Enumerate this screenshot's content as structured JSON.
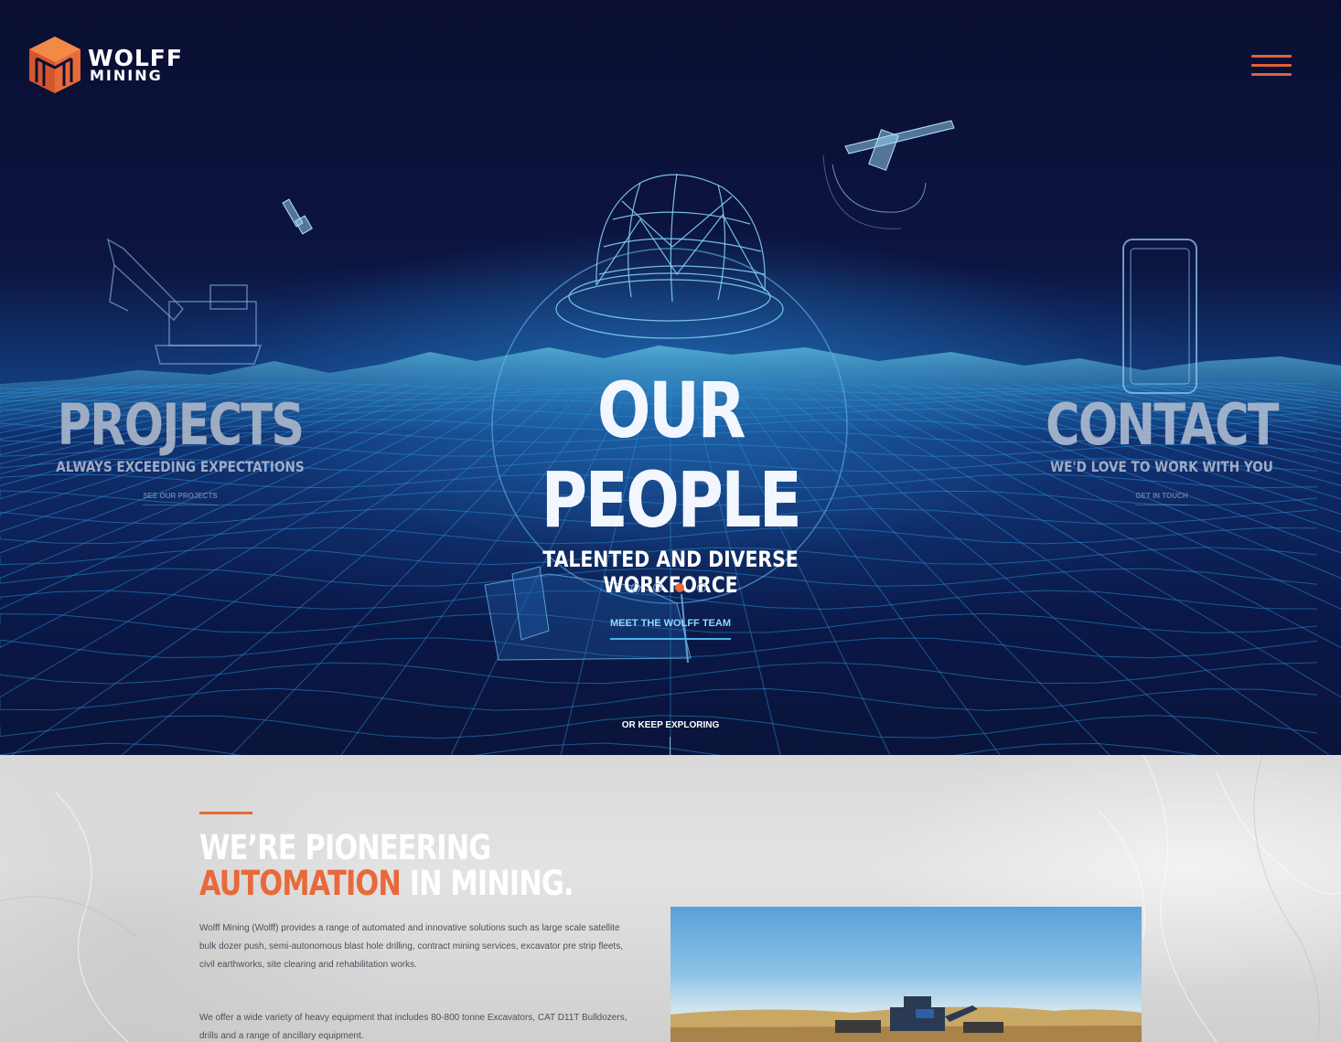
{
  "header": {
    "logo_line1": "WOLFF",
    "logo_line2": "MINING",
    "menu_icon": "hamburger-menu-icon"
  },
  "hero": {
    "panels": [
      {
        "title": "PROJECTS",
        "subtitle": "ALWAYS EXCEEDING EXPECTATIONS",
        "link": "SEE OUR PROJECTS"
      },
      {
        "title": "OUR PEOPLE",
        "subtitle": "TALENTED AND DIVERSE WORKFORCE",
        "link": "MEET THE WOLFF TEAM"
      },
      {
        "title": "CONTACT",
        "subtitle": "WE'D LOVE TO WORK WITH YOU",
        "link": "GET IN TOUCH"
      }
    ],
    "slider_dots": 4,
    "active_dot": 3,
    "explore": "OR KEEP EXPLORING"
  },
  "about": {
    "heading_line1": "WE’RE PIONEERING",
    "heading_accent": "AUTOMATION",
    "heading_rest": " IN MINING.",
    "paragraph1": "Wolff Mining (Wolff) provides a range of automated and innovative solutions such as large scale satellite bulk dozer push, semi-autonomous blast hole drilling, contract mining services, excavator pre strip fleets, civil earthworks, site clearing and rehabilitation works.",
    "paragraph2": "We offer a wide variety of heavy equipment that includes 80-800 tonne Excavators, CAT D11T Bulldozers, drills and a range of ancillary equipment."
  },
  "colors": {
    "accent": "#e8693a",
    "hero_bg": "#0b1033",
    "wireframe": "#2a9de0"
  }
}
